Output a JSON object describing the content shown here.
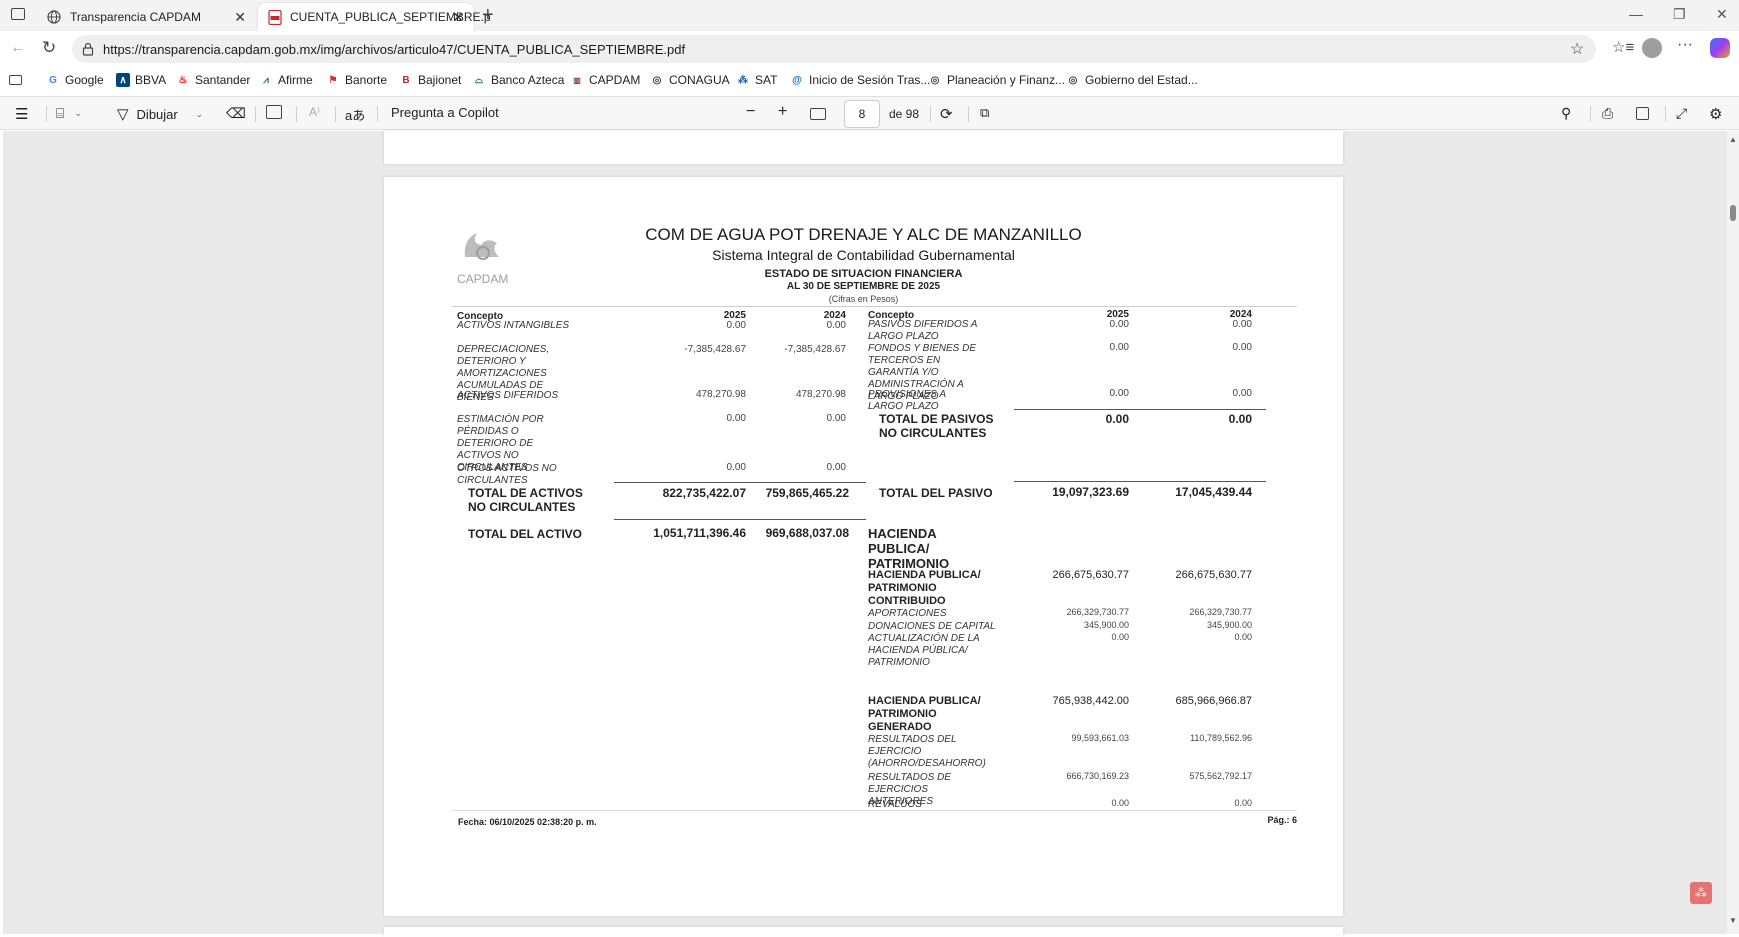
{
  "tabs": [
    {
      "title": "Transparencia CAPDAM",
      "icon": "globe-icon"
    },
    {
      "title": "CUENTA_PUBLICA_SEPTIEMBRE.p",
      "icon": "pdf-icon"
    }
  ],
  "address": {
    "url": "https://transparencia.capdam.gob.mx/img/archivos/articulo47/CUENTA_PUBLICA_SEPTIEMBRE.pdf"
  },
  "bookmarks": [
    {
      "label": "Google",
      "icon": "google-icon"
    },
    {
      "label": "BBVA",
      "icon": "bbva-icon"
    },
    {
      "label": "Santander",
      "icon": "santander-icon"
    },
    {
      "label": "Afirme",
      "icon": "afirme-icon"
    },
    {
      "label": "Banorte",
      "icon": "banorte-icon"
    },
    {
      "label": "Bajionet",
      "icon": "bajionet-icon"
    },
    {
      "label": "Banco Azteca",
      "icon": "banco-azteca-icon"
    },
    {
      "label": "CAPDAM",
      "icon": "capdam-icon"
    },
    {
      "label": "CONAGUA",
      "icon": "globe-icon"
    },
    {
      "label": "SAT",
      "icon": "sat-icon"
    },
    {
      "label": "Inicio de Sesión Tras...",
      "icon": "login-icon"
    },
    {
      "label": "Planeación y Finanz...",
      "icon": "globe-icon"
    },
    {
      "label": "Gobierno del Estad...",
      "icon": "globe-icon"
    }
  ],
  "pdf_toolbar": {
    "draw_label": "Dibujar",
    "copilot_label": "Pregunta a Copilot",
    "page_current": "8",
    "page_total": "de 98"
  },
  "document": {
    "org": "COM DE AGUA POT DRENAJE Y ALC DE MANZANILLO",
    "system": "Sistema Integral de Contabilidad Gubernamental",
    "report": "ESTADO DE SITUACION FINANCIERA",
    "date": "AL 30 DE SEPTIEMBRE DE 2025",
    "units": "(Cifras en Pesos)",
    "logo_text": "CAPDAM",
    "left_header": {
      "concept": "Concepto",
      "y1": "2025",
      "y2": "2024"
    },
    "right_header": {
      "concept": "Concepto",
      "y1": "2025",
      "y2": "2024"
    },
    "left_rows": [
      {
        "label": "ACTIVOS INTANGIBLES",
        "v1": "0.00",
        "v2": "0.00"
      },
      {
        "label": "DEPRECIACIONES, DETERIORO Y AMORTIZACIONES ACUMULADAS DE BIENES",
        "v1": "-7,385,428.67",
        "v2": "-7,385,428.67"
      },
      {
        "label": "ACTIVOS DIFERIDOS",
        "v1": "478,270.98",
        "v2": "478,270.98"
      },
      {
        "label": "ESTIMACIÓN POR PÉRDIDAS O DETERIORO DE ACTIVOS NO CIRCULANTES",
        "v1": "0.00",
        "v2": "0.00"
      },
      {
        "label": "OTROS ACTIVOS NO CIRCULANTES",
        "v1": "0.00",
        "v2": "0.00"
      }
    ],
    "left_totals": [
      {
        "label": "TOTAL DE ACTIVOS NO CIRCULANTES",
        "v1": "822,735,422.07",
        "v2": "759,865,465.22"
      },
      {
        "label": "TOTAL DEL ACTIVO",
        "v1": "1,051,711,396.46",
        "v2": "969,688,037.08"
      }
    ],
    "right_rows": [
      {
        "label": "PASIVOS DIFERIDOS A LARGO PLAZO",
        "v1": "0.00",
        "v2": "0.00"
      },
      {
        "label": "FONDOS Y BIENES DE TERCEROS EN GARANTÍA Y/O ADMINISTRACIÓN A LARGO PLAZO",
        "v1": "0.00",
        "v2": "0.00"
      },
      {
        "label": "PROVISIONES A LARGO PLAZO",
        "v1": "0.00",
        "v2": "0.00"
      }
    ],
    "right_totals": [
      {
        "label": "TOTAL DE PASIVOS NO CIRCULANTES",
        "v1": "0.00",
        "v2": "0.00"
      },
      {
        "label": "TOTAL DEL PASIVO",
        "v1": "19,097,323.69",
        "v2": "17,045,439.44"
      }
    ],
    "hacienda_title": "HACIENDA PUBLICA/ PATRIMONIO",
    "contribuido": {
      "label": "HACIENDA PUBLICA/ PATRIMONIO CONTRIBUIDO",
      "v1": "266,675,630.77",
      "v2": "266,675,630.77"
    },
    "contribuido_rows": [
      {
        "label": "APORTACIONES",
        "v1": "266,329,730.77",
        "v2": "266,329,730.77"
      },
      {
        "label": "DONACIONES DE CAPITAL",
        "v1": "345,900.00",
        "v2": "345,900.00"
      },
      {
        "label": "ACTUALIZACIÓN DE LA HACIENDA PÚBLICA/ PATRIMONIO",
        "v1": "0.00",
        "v2": "0.00"
      }
    ],
    "generado": {
      "label": "HACIENDA PUBLICA/ PATRIMONIO GENERADO",
      "v1": "765,938,442.00",
      "v2": "685,966,966.87"
    },
    "generado_rows": [
      {
        "label": "RESULTADOS DEL EJERCICIO (AHORRO/DESAHORRO)",
        "v1": "99,593,661.03",
        "v2": "110,789,562.96"
      },
      {
        "label": "RESULTADOS DE EJERCICIOS ANTERIORES",
        "v1": "666,730,169.23",
        "v2": "575,562,792.17"
      },
      {
        "label": "REVALÚOS",
        "v1": "0.00",
        "v2": "0.00"
      }
    ],
    "footer_date": "Fecha: 06/10/2025 02:38:20 p. m.",
    "footer_page": "Pág.: 6"
  }
}
